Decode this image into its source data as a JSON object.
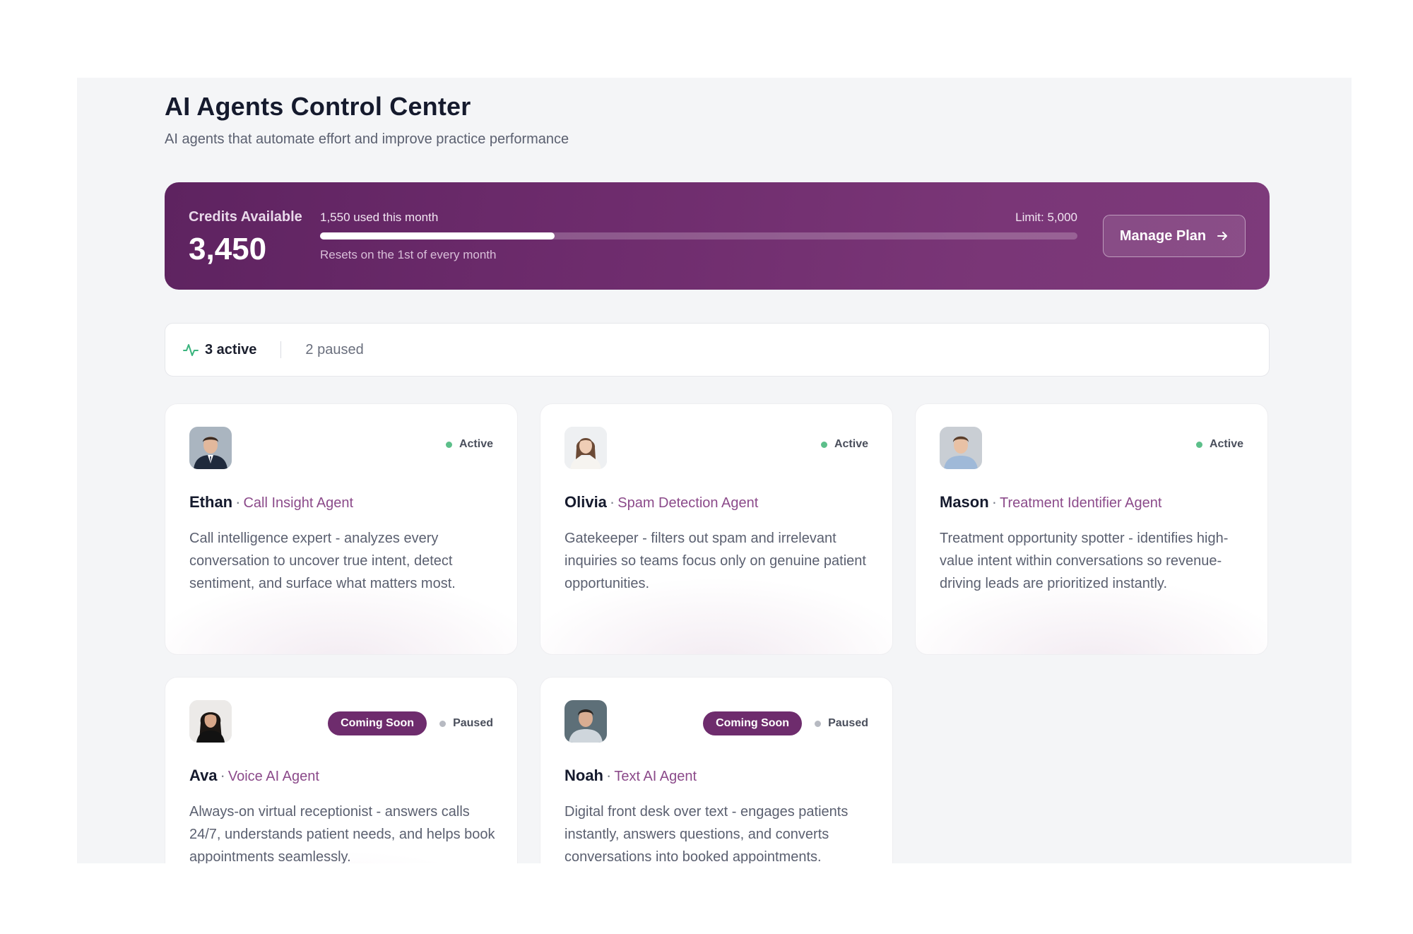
{
  "header": {
    "title": "AI Agents Control Center",
    "subtitle": "AI agents that automate effort and improve practice performance"
  },
  "credits": {
    "label": "Credits Available",
    "value": "3,450",
    "usage_text": "1,550 used this month",
    "limit_text": "Limit: 5,000",
    "reset_text": "Resets on the 1st of every month",
    "progress_fraction": 0.31,
    "manage_label": "Manage Plan",
    "manage_icon": "arrow-right-icon"
  },
  "status": {
    "active_label": "3 active",
    "paused_label": "2 paused",
    "active_icon": "activity-icon"
  },
  "colors": {
    "brand": "#6e2c6d",
    "active_green": "#5cbf8a",
    "paused_gray": "#b7bac2",
    "role_text": "#8b4a8a"
  },
  "agents": [
    {
      "name": "Ethan",
      "role": "Call Insight Agent",
      "status": "Active",
      "badge": "",
      "description": "Call intelligence expert - analyzes every conversation to uncover true intent, detect sentiment, and surface what matters most."
    },
    {
      "name": "Olivia",
      "role": "Spam Detection Agent",
      "status": "Active",
      "badge": "",
      "description": "Gatekeeper - filters out spam and irrelevant inquiries so teams focus only on genuine patient opportunities."
    },
    {
      "name": "Mason",
      "role": "Treatment Identifier Agent",
      "status": "Active",
      "badge": "",
      "description": "Treatment opportunity spotter - identifies high-value intent within conversations so revenue-driving leads are prioritized instantly."
    },
    {
      "name": "Ava",
      "role": "Voice AI Agent",
      "status": "Paused",
      "badge": "Coming Soon",
      "description": "Always-on virtual receptionist - answers calls 24/7, understands patient needs, and helps book appointments seamlessly."
    },
    {
      "name": "Noah",
      "role": "Text AI Agent",
      "status": "Paused",
      "badge": "Coming Soon",
      "description": "Digital front desk over text - engages patients instantly, answers questions, and converts conversations into booked appointments."
    }
  ]
}
